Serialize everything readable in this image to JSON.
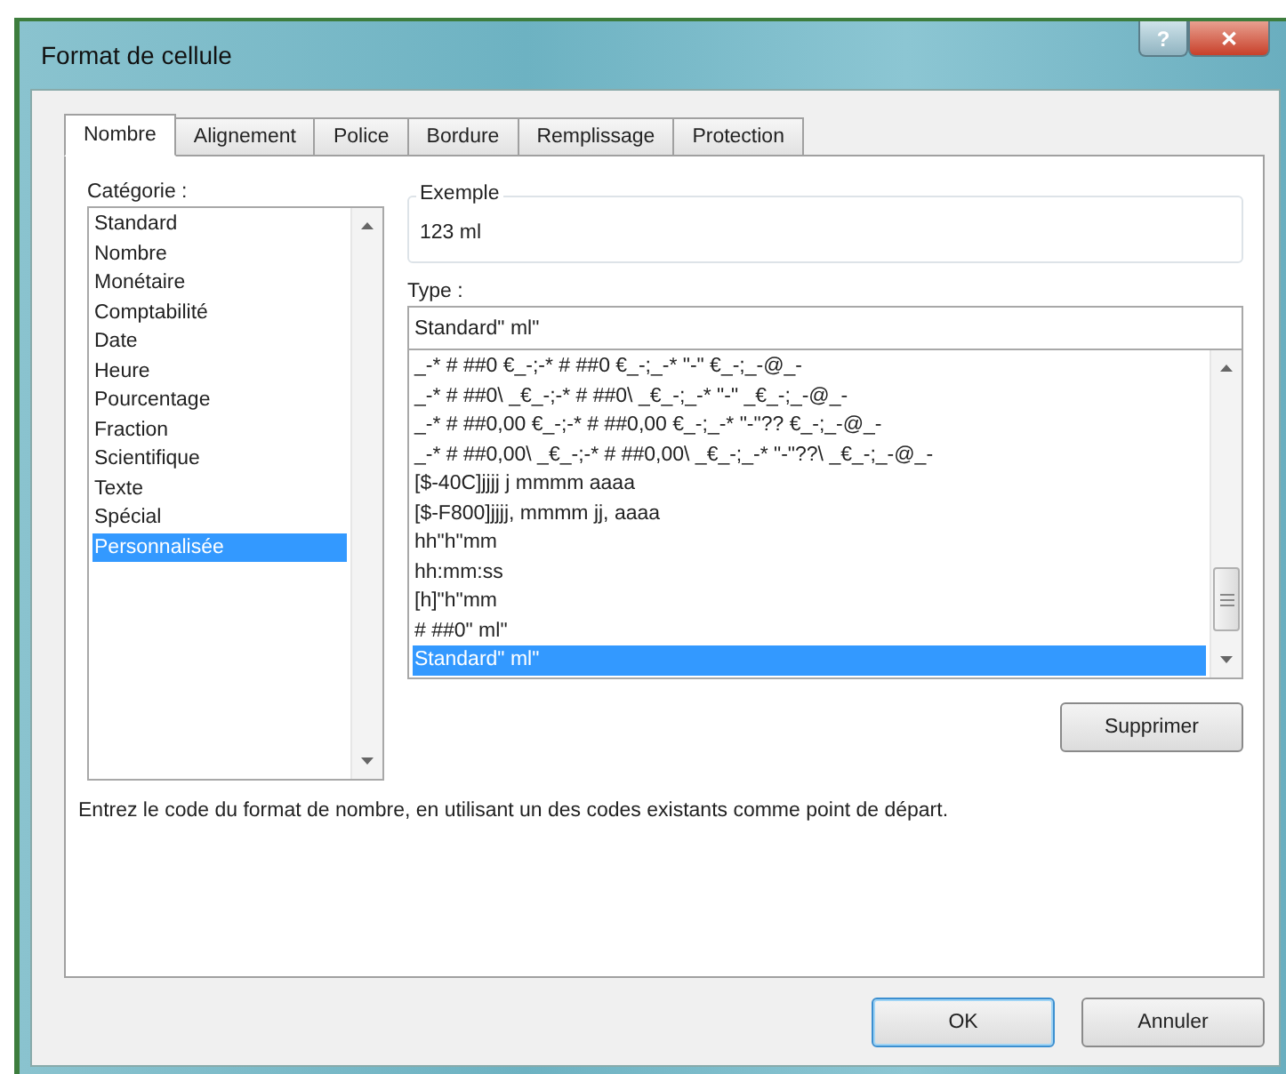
{
  "window": {
    "title": "Format de cellule"
  },
  "title_buttons": [
    {
      "kind": "help",
      "label": "?"
    },
    {
      "kind": "close",
      "label": "✕"
    }
  ],
  "tabs": [
    {
      "label": "Nombre",
      "selected": true
    },
    {
      "label": "Alignement",
      "selected": false
    },
    {
      "label": "Police",
      "selected": false
    },
    {
      "label": "Bordure",
      "selected": false
    },
    {
      "label": "Remplissage",
      "selected": false
    },
    {
      "label": "Protection",
      "selected": false
    }
  ],
  "category": {
    "label": "Catégorie :",
    "items": [
      {
        "label": "Standard",
        "selected": false
      },
      {
        "label": "Nombre",
        "selected": false
      },
      {
        "label": "Monétaire",
        "selected": false
      },
      {
        "label": "Comptabilité",
        "selected": false
      },
      {
        "label": "Date",
        "selected": false
      },
      {
        "label": "Heure",
        "selected": false
      },
      {
        "label": "Pourcentage",
        "selected": false
      },
      {
        "label": "Fraction",
        "selected": false
      },
      {
        "label": "Scientifique",
        "selected": false
      },
      {
        "label": "Texte",
        "selected": false
      },
      {
        "label": "Spécial",
        "selected": false
      },
      {
        "label": "Personnalisée",
        "selected": true
      }
    ]
  },
  "sample": {
    "label": "Exemple",
    "value": "123 ml"
  },
  "type": {
    "label": "Type :",
    "value": "Standard\" ml\"",
    "items": [
      {
        "label": "_-* # ##0 €_-;-* # ##0 €_-;_-* \"-\" €_-;_-@_-",
        "selected": false
      },
      {
        "label": "_-* # ##0\\ _€_-;-* # ##0\\ _€_-;_-* \"-\" _€_-;_-@_-",
        "selected": false
      },
      {
        "label": "_-* # ##0,00 €_-;-* # ##0,00 €_-;_-* \"-\"?? €_-;_-@_-",
        "selected": false
      },
      {
        "label": "_-* # ##0,00\\ _€_-;-* # ##0,00\\ _€_-;_-* \"-\"??\\ _€_-;_-@_-",
        "selected": false
      },
      {
        "label": "[$-40C]jjjj j mmmm aaaa",
        "selected": false
      },
      {
        "label": "[$-F800]jjjj, mmmm jj, aaaa",
        "selected": false
      },
      {
        "label": "hh\"h\"mm",
        "selected": false
      },
      {
        "label": "hh:mm:ss",
        "selected": false
      },
      {
        "label": "[h]\"h\"mm",
        "selected": false
      },
      {
        "label": "# ##0\" ml\"",
        "selected": false
      },
      {
        "label": "Standard\" ml\"",
        "selected": true
      }
    ]
  },
  "delete_button": "Supprimer",
  "description": "Entrez le code du format de nombre, en utilisant un des codes existants comme point de départ.",
  "buttons": [
    {
      "label": "OK",
      "default": true
    },
    {
      "label": "Annuler",
      "default": false
    }
  ]
}
